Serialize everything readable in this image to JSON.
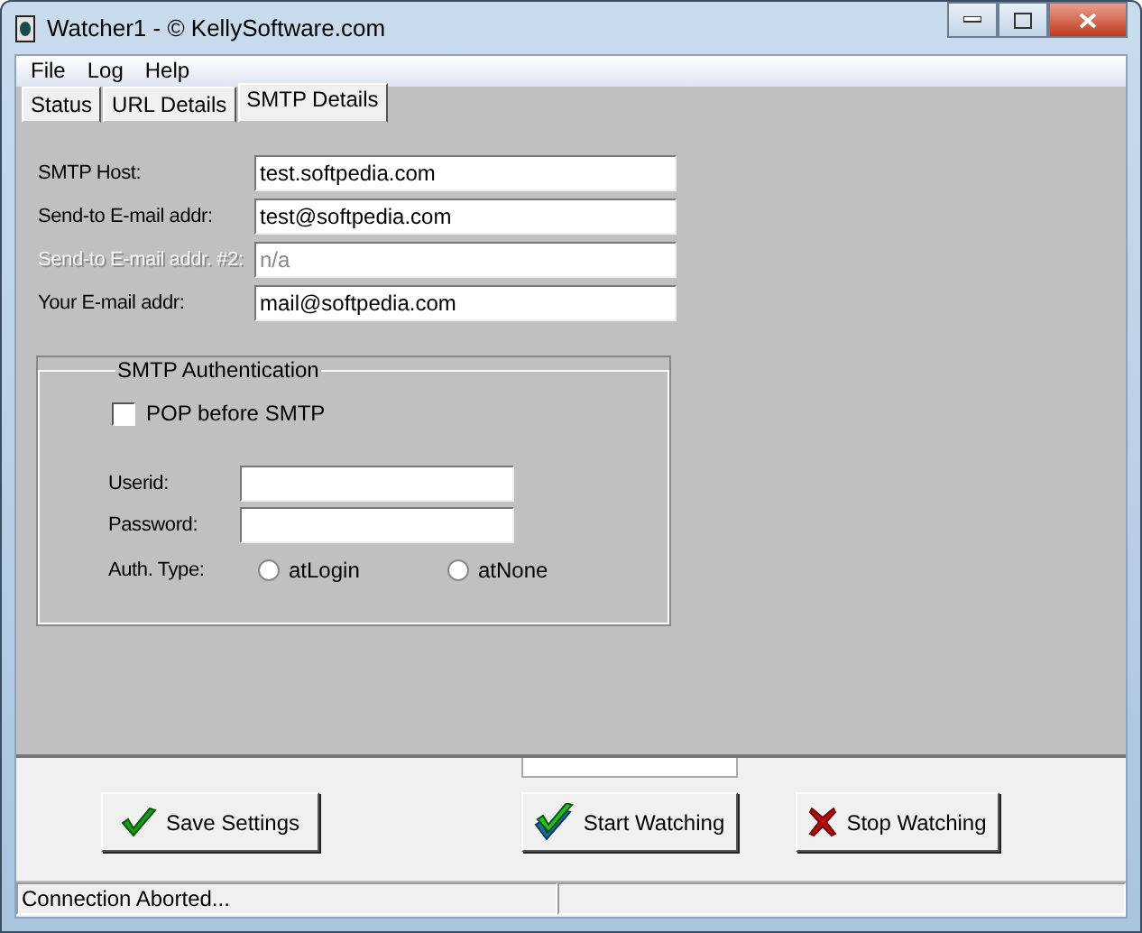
{
  "window": {
    "title": "Watcher1 - © KellySoftware.com"
  },
  "menu": [
    "File",
    "Log",
    "Help"
  ],
  "tabs": [
    {
      "label": "Status",
      "selected": false
    },
    {
      "label": "URL Details",
      "selected": false
    },
    {
      "label": "SMTP Details",
      "selected": true
    }
  ],
  "smtp_fields": [
    {
      "label": "SMTP Host:",
      "value": "test.softpedia.com",
      "disabled": false
    },
    {
      "label": "Send-to E-mail addr:",
      "value": "test@softpedia.com",
      "disabled": false
    },
    {
      "label": "Send-to E-mail addr. #2:",
      "value": "n/a",
      "disabled": true
    },
    {
      "label": "Your E-mail addr:",
      "value": "mail@softpedia.com",
      "disabled": false
    }
  ],
  "auth": {
    "title": "SMTP Authentication",
    "pop_before_smtp": {
      "label": "POP before SMTP",
      "checked": false
    },
    "fields": [
      {
        "label": "Userid:"
      },
      {
        "label": "Password:"
      }
    ],
    "auth_type": {
      "label": "Auth. Type:",
      "options": [
        {
          "label": "atLogin",
          "selected": false
        },
        {
          "label": "atNone",
          "selected": false
        }
      ]
    }
  },
  "buttons": [
    {
      "label": "Save Settings",
      "kind": "check"
    },
    {
      "label": "Start Watching",
      "kind": "doublecheck"
    },
    {
      "label": "Stop Watching",
      "kind": "cross"
    }
  ],
  "status_bar": {
    "message": "Connection Aborted..."
  }
}
